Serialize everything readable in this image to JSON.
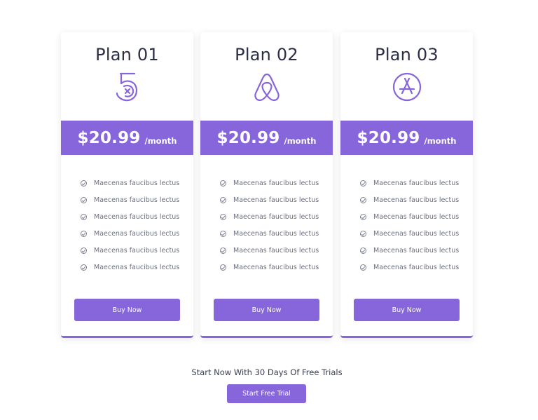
{
  "accent_color": "#8766db",
  "plans": [
    {
      "title": "Plan 01",
      "logo_icon": "numeral-5-logo-icon",
      "price": "$20.99",
      "period": "/month",
      "features": [
        "Maecenas faucibus lectus",
        "Maecenas faucibus lectus",
        "Maecenas faucibus lectus",
        "Maecenas faucibus lectus",
        "Maecenas faucibus lectus",
        "Maecenas faucibus lectus"
      ],
      "button_label": "Buy Now"
    },
    {
      "title": "Plan 02",
      "logo_icon": "airbnb-logo-icon",
      "price": "$20.99",
      "period": "/month",
      "features": [
        "Maecenas faucibus lectus",
        "Maecenas faucibus lectus",
        "Maecenas faucibus lectus",
        "Maecenas faucibus lectus",
        "Maecenas faucibus lectus",
        "Maecenas faucibus lectus"
      ],
      "button_label": "Buy Now"
    },
    {
      "title": "Plan 03",
      "logo_icon": "app-store-logo-icon",
      "price": "$20.99",
      "period": "/month",
      "features": [
        "Maecenas faucibus lectus",
        "Maecenas faucibus lectus",
        "Maecenas faucibus lectus",
        "Maecenas faucibus lectus",
        "Maecenas faucibus lectus",
        "Maecenas faucibus lectus"
      ],
      "button_label": "Buy Now"
    }
  ],
  "trial": {
    "text": "Start Now With 30 Days Of Free Trials",
    "button_label": "Start Free Trial"
  }
}
